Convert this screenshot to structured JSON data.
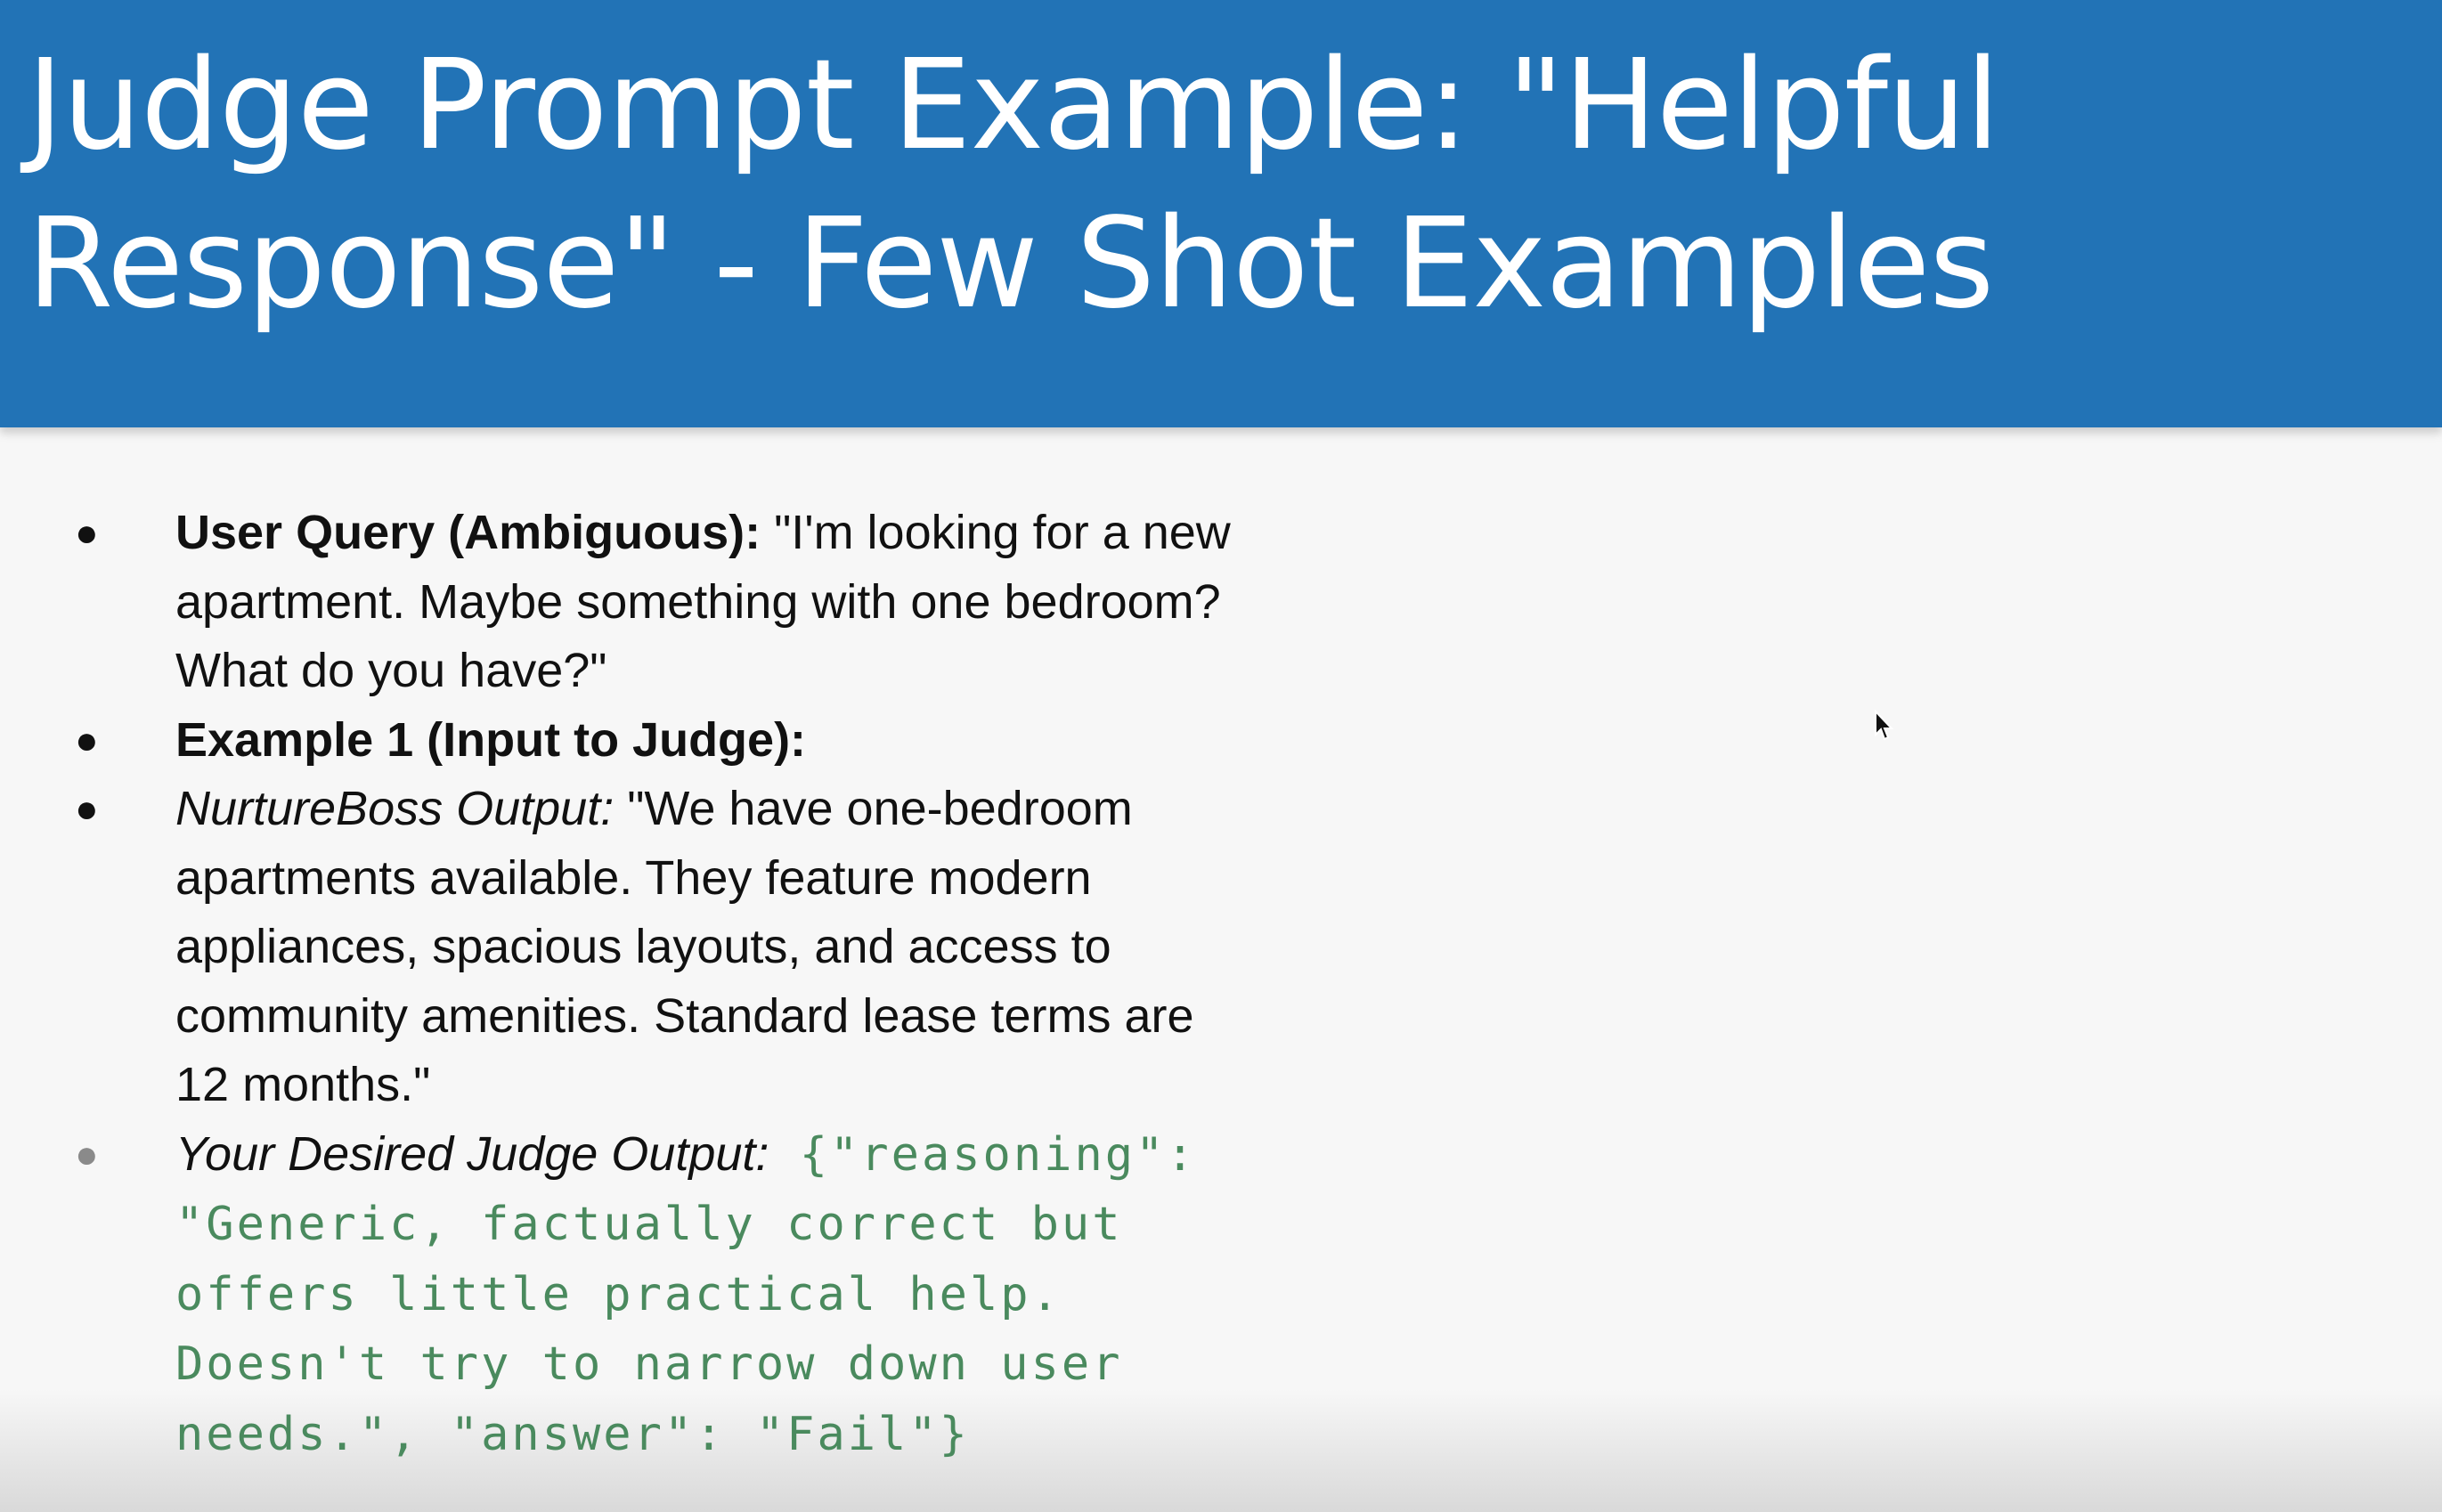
{
  "slide": {
    "title_line1": "Judge Prompt Example: \"Helpful",
    "title_line2": "Response\" - Few Shot Examples",
    "bullets": [
      {
        "label": "User Query (Ambiguous):",
        "text_lines": [
          " \"I'm looking for a new",
          "apartment. Maybe something with one bedroom?",
          "What do you have?\""
        ]
      },
      {
        "label": "Example 1 (Input to Judge):"
      },
      {
        "label": "NurtureBoss Output:",
        "text_lines": [
          " \"We have one-bedroom",
          "apartments available. They feature modern",
          "appliances, spacious layouts, and access to",
          "community amenities. Standard lease terms are",
          "12 months.\""
        ]
      },
      {
        "label": "Your Desired Judge Output:",
        "code_lines": [
          " {\"reasoning\":",
          "\"Generic, factually correct but",
          "offers little practical help.",
          "Doesn't try to narrow down user",
          "needs.\", \"answer\": \"Fail\"}"
        ]
      }
    ]
  },
  "bullet_glyph": "●",
  "colors": {
    "header_bg": "#2273b6",
    "title_text": "#ffffff",
    "body_text": "#111111",
    "code_text": "#4a8a5e",
    "slide_bg": "#f7f7f7"
  },
  "icons": {
    "cursor": "mouse-pointer-icon"
  }
}
